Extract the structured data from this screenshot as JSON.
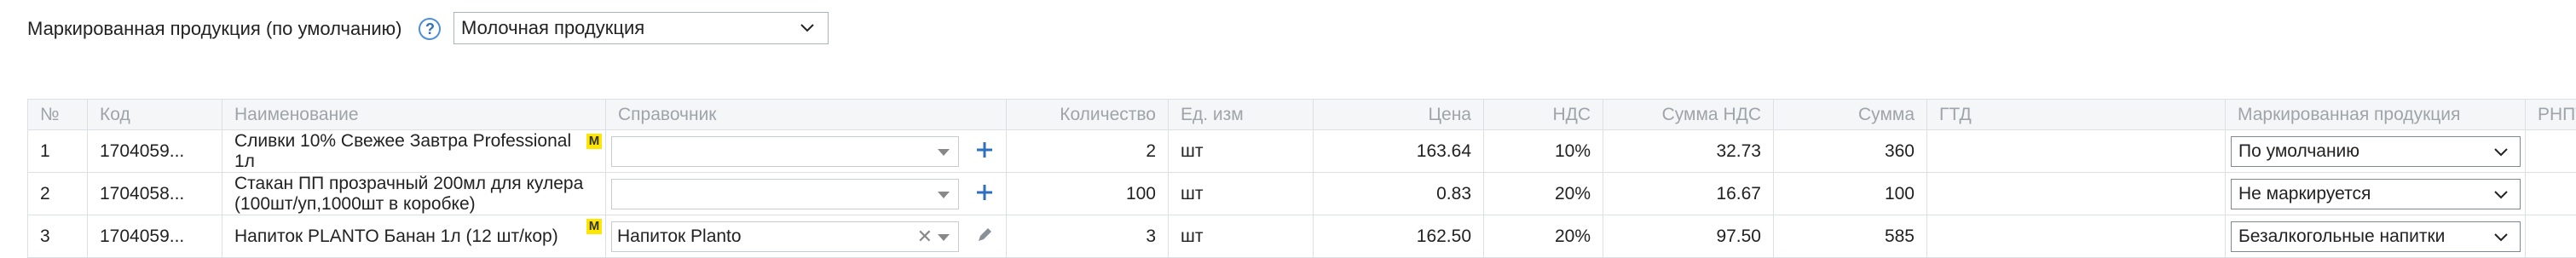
{
  "top": {
    "label": "Маркированная продукция (по умолчанию)",
    "help": "?",
    "select_value": "Молочная продукция"
  },
  "columns": [
    "№",
    "Код",
    "Наименование",
    "Справочник",
    "Количество",
    "Ед. изм",
    "Цена",
    "НДС",
    "Сумма НДС",
    "Сумма",
    "ГТД",
    "Маркированная продукция",
    "РНПТ"
  ],
  "rows": [
    {
      "num": "1",
      "code": "1704059...",
      "name": "Сливки 10% Свежее Завтра Professional 1л",
      "badge": "М",
      "ref_value": "",
      "ref_action": "plus-icon",
      "qty": "2",
      "unit": "шт",
      "price": "163.64",
      "vat": "10%",
      "vat_sum": "32.73",
      "sum": "360",
      "gtd": "",
      "marked": "По умолчанию",
      "rnpt": ""
    },
    {
      "num": "2",
      "code": "1704058...",
      "name": "Стакан ПП прозрачный 200мл для кулера (100шт/уп,1000шт в коробке)",
      "badge": "",
      "ref_value": "",
      "ref_action": "plus-icon",
      "qty": "100",
      "unit": "шт",
      "price": "0.83",
      "vat": "20%",
      "vat_sum": "16.67",
      "sum": "100",
      "gtd": "",
      "marked": "Не маркируется",
      "rnpt": ""
    },
    {
      "num": "3",
      "code": "1704059...",
      "name": "Напиток PLANTO Банан 1л (12 шт/кор)",
      "badge": "М",
      "ref_value": "Напиток Planto",
      "ref_clear": "✕",
      "ref_action": "pencil-icon",
      "qty": "3",
      "unit": "шт",
      "price": "162.50",
      "vat": "20%",
      "vat_sum": "97.50",
      "sum": "585",
      "gtd": "",
      "marked": "Безалкогольные напитки",
      "rnpt": ""
    }
  ],
  "colors": {
    "accent": "#2f6fc0",
    "badge": "#ffe600",
    "header_bg": "#f5f6f7",
    "border": "#dcdfe3"
  }
}
